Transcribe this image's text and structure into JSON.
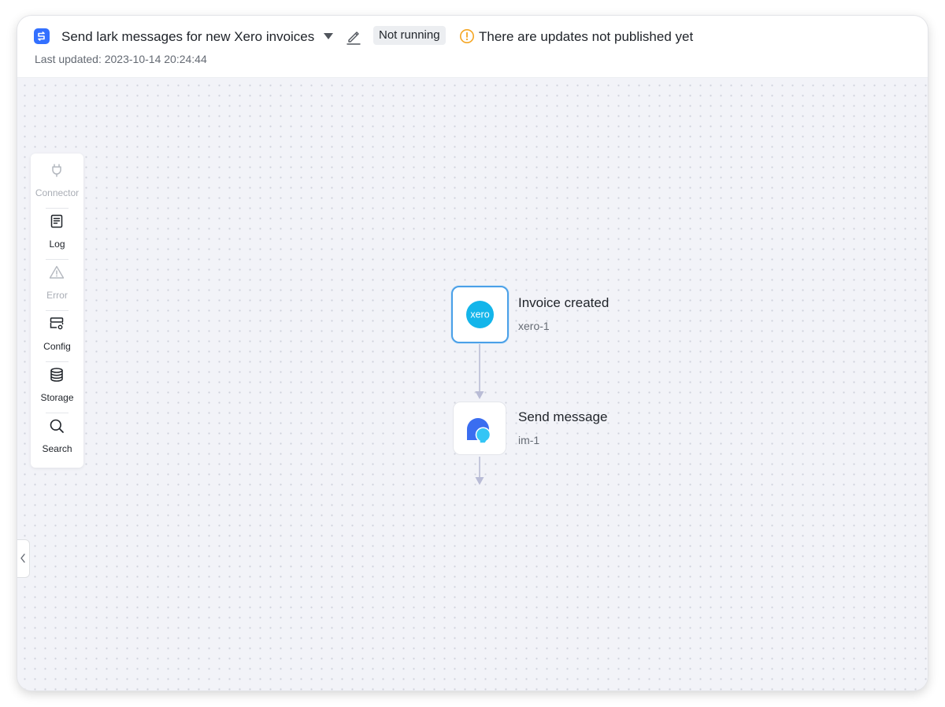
{
  "header": {
    "title": "Send lark messages for new Xero invoices",
    "status": "Not running",
    "warning": "There are updates not published yet",
    "last_updated": "Last updated: 2023-10-14 20:24:44"
  },
  "toolbar": {
    "items": [
      {
        "label": "Connector",
        "icon": "plug-icon",
        "enabled": false
      },
      {
        "label": "Log",
        "icon": "log-document-icon",
        "enabled": true
      },
      {
        "label": "Error",
        "icon": "warning-triangle-icon",
        "enabled": false
      },
      {
        "label": "Config",
        "icon": "config-icon",
        "enabled": true
      },
      {
        "label": "Storage",
        "icon": "database-icon",
        "enabled": true
      },
      {
        "label": "Search",
        "icon": "search-icon",
        "enabled": true
      }
    ]
  },
  "flow": {
    "nodes": [
      {
        "title": "Invoice created",
        "id": "xero-1",
        "logo_text": "xero",
        "icon": "xero-logo-icon"
      },
      {
        "title": "Send message",
        "id": "im-1",
        "icon": "chat-bubbles-icon"
      }
    ]
  },
  "colors": {
    "accent": "#3370ff",
    "xero": "#13b5ea",
    "warning": "#f5a623",
    "connector": "#b9bcd6",
    "selected_border": "#4aa0e8"
  }
}
